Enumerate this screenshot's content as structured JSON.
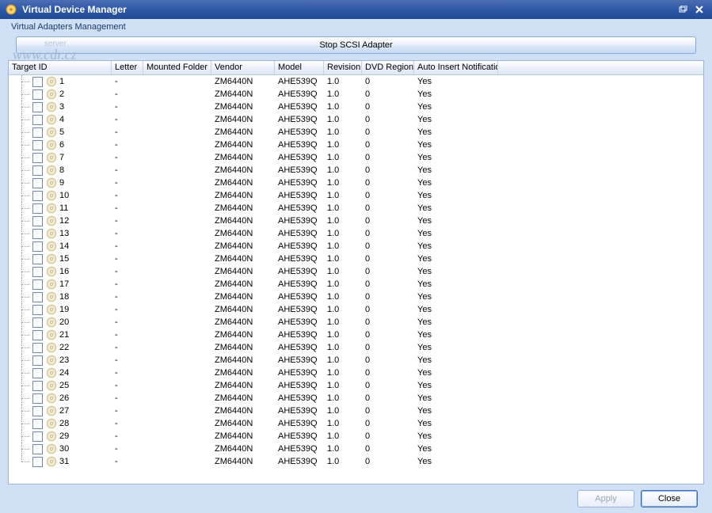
{
  "window": {
    "title": "Virtual Device Manager",
    "section_label": "Virtual Adapters Management",
    "stop_button": "Stop SCSI Adapter"
  },
  "watermark": {
    "server": "server",
    "url": "www.cdr.cz"
  },
  "columns": [
    "Target ID",
    "Letter",
    "Mounted Folder",
    "Vendor",
    "Model",
    "Revision",
    "DVD Region",
    "Auto Insert Notification"
  ],
  "rows": [
    {
      "id": "1",
      "letter": "-",
      "folder": "",
      "vendor": "ZM6440N",
      "model": "AHE539Q",
      "rev": "1.0",
      "region": "0",
      "ain": "Yes"
    },
    {
      "id": "2",
      "letter": "-",
      "folder": "",
      "vendor": "ZM6440N",
      "model": "AHE539Q",
      "rev": "1.0",
      "region": "0",
      "ain": "Yes"
    },
    {
      "id": "3",
      "letter": "-",
      "folder": "",
      "vendor": "ZM6440N",
      "model": "AHE539Q",
      "rev": "1.0",
      "region": "0",
      "ain": "Yes"
    },
    {
      "id": "4",
      "letter": "-",
      "folder": "",
      "vendor": "ZM6440N",
      "model": "AHE539Q",
      "rev": "1.0",
      "region": "0",
      "ain": "Yes"
    },
    {
      "id": "5",
      "letter": "-",
      "folder": "",
      "vendor": "ZM6440N",
      "model": "AHE539Q",
      "rev": "1.0",
      "region": "0",
      "ain": "Yes"
    },
    {
      "id": "6",
      "letter": "-",
      "folder": "",
      "vendor": "ZM6440N",
      "model": "AHE539Q",
      "rev": "1.0",
      "region": "0",
      "ain": "Yes"
    },
    {
      "id": "7",
      "letter": "-",
      "folder": "",
      "vendor": "ZM6440N",
      "model": "AHE539Q",
      "rev": "1.0",
      "region": "0",
      "ain": "Yes"
    },
    {
      "id": "8",
      "letter": "-",
      "folder": "",
      "vendor": "ZM6440N",
      "model": "AHE539Q",
      "rev": "1.0",
      "region": "0",
      "ain": "Yes"
    },
    {
      "id": "9",
      "letter": "-",
      "folder": "",
      "vendor": "ZM6440N",
      "model": "AHE539Q",
      "rev": "1.0",
      "region": "0",
      "ain": "Yes"
    },
    {
      "id": "10",
      "letter": "-",
      "folder": "",
      "vendor": "ZM6440N",
      "model": "AHE539Q",
      "rev": "1.0",
      "region": "0",
      "ain": "Yes"
    },
    {
      "id": "11",
      "letter": "-",
      "folder": "",
      "vendor": "ZM6440N",
      "model": "AHE539Q",
      "rev": "1.0",
      "region": "0",
      "ain": "Yes"
    },
    {
      "id": "12",
      "letter": "-",
      "folder": "",
      "vendor": "ZM6440N",
      "model": "AHE539Q",
      "rev": "1.0",
      "region": "0",
      "ain": "Yes"
    },
    {
      "id": "13",
      "letter": "-",
      "folder": "",
      "vendor": "ZM6440N",
      "model": "AHE539Q",
      "rev": "1.0",
      "region": "0",
      "ain": "Yes"
    },
    {
      "id": "14",
      "letter": "-",
      "folder": "",
      "vendor": "ZM6440N",
      "model": "AHE539Q",
      "rev": "1.0",
      "region": "0",
      "ain": "Yes"
    },
    {
      "id": "15",
      "letter": "-",
      "folder": "",
      "vendor": "ZM6440N",
      "model": "AHE539Q",
      "rev": "1.0",
      "region": "0",
      "ain": "Yes"
    },
    {
      "id": "16",
      "letter": "-",
      "folder": "",
      "vendor": "ZM6440N",
      "model": "AHE539Q",
      "rev": "1.0",
      "region": "0",
      "ain": "Yes"
    },
    {
      "id": "17",
      "letter": "-",
      "folder": "",
      "vendor": "ZM6440N",
      "model": "AHE539Q",
      "rev": "1.0",
      "region": "0",
      "ain": "Yes"
    },
    {
      "id": "18",
      "letter": "-",
      "folder": "",
      "vendor": "ZM6440N",
      "model": "AHE539Q",
      "rev": "1.0",
      "region": "0",
      "ain": "Yes"
    },
    {
      "id": "19",
      "letter": "-",
      "folder": "",
      "vendor": "ZM6440N",
      "model": "AHE539Q",
      "rev": "1.0",
      "region": "0",
      "ain": "Yes"
    },
    {
      "id": "20",
      "letter": "-",
      "folder": "",
      "vendor": "ZM6440N",
      "model": "AHE539Q",
      "rev": "1.0",
      "region": "0",
      "ain": "Yes"
    },
    {
      "id": "21",
      "letter": "-",
      "folder": "",
      "vendor": "ZM6440N",
      "model": "AHE539Q",
      "rev": "1.0",
      "region": "0",
      "ain": "Yes"
    },
    {
      "id": "22",
      "letter": "-",
      "folder": "",
      "vendor": "ZM6440N",
      "model": "AHE539Q",
      "rev": "1.0",
      "region": "0",
      "ain": "Yes"
    },
    {
      "id": "23",
      "letter": "-",
      "folder": "",
      "vendor": "ZM6440N",
      "model": "AHE539Q",
      "rev": "1.0",
      "region": "0",
      "ain": "Yes"
    },
    {
      "id": "24",
      "letter": "-",
      "folder": "",
      "vendor": "ZM6440N",
      "model": "AHE539Q",
      "rev": "1.0",
      "region": "0",
      "ain": "Yes"
    },
    {
      "id": "25",
      "letter": "-",
      "folder": "",
      "vendor": "ZM6440N",
      "model": "AHE539Q",
      "rev": "1.0",
      "region": "0",
      "ain": "Yes"
    },
    {
      "id": "26",
      "letter": "-",
      "folder": "",
      "vendor": "ZM6440N",
      "model": "AHE539Q",
      "rev": "1.0",
      "region": "0",
      "ain": "Yes"
    },
    {
      "id": "27",
      "letter": "-",
      "folder": "",
      "vendor": "ZM6440N",
      "model": "AHE539Q",
      "rev": "1.0",
      "region": "0",
      "ain": "Yes"
    },
    {
      "id": "28",
      "letter": "-",
      "folder": "",
      "vendor": "ZM6440N",
      "model": "AHE539Q",
      "rev": "1.0",
      "region": "0",
      "ain": "Yes"
    },
    {
      "id": "29",
      "letter": "-",
      "folder": "",
      "vendor": "ZM6440N",
      "model": "AHE539Q",
      "rev": "1.0",
      "region": "0",
      "ain": "Yes"
    },
    {
      "id": "30",
      "letter": "-",
      "folder": "",
      "vendor": "ZM6440N",
      "model": "AHE539Q",
      "rev": "1.0",
      "region": "0",
      "ain": "Yes"
    },
    {
      "id": "31",
      "letter": "-",
      "folder": "",
      "vendor": "ZM6440N",
      "model": "AHE539Q",
      "rev": "1.0",
      "region": "0",
      "ain": "Yes"
    }
  ],
  "footer": {
    "apply": "Apply",
    "close": "Close"
  }
}
